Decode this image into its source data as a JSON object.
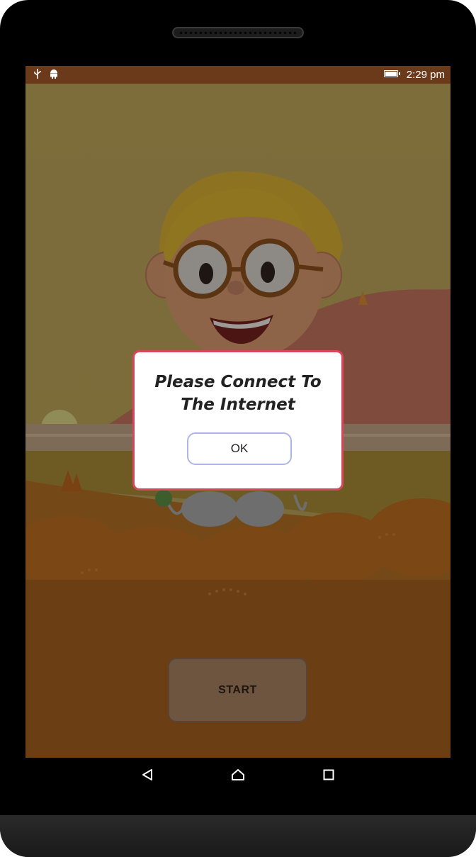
{
  "statusbar": {
    "time": "2:29 pm",
    "icons": [
      "usb-icon",
      "android-debug-icon",
      "battery-icon"
    ],
    "battery_level": 1.0
  },
  "game": {
    "start_label": "START"
  },
  "dialog": {
    "message": "Please Connect To The Internet",
    "ok_label": "OK"
  },
  "navbar": {
    "icons": [
      "back-icon",
      "home-icon",
      "recents-icon"
    ]
  },
  "colors": {
    "statusbar": "#6b3a1b",
    "dialog_border": "#d9475a",
    "ok_border": "#aeb5e8",
    "start_bg": "#6e5540"
  }
}
